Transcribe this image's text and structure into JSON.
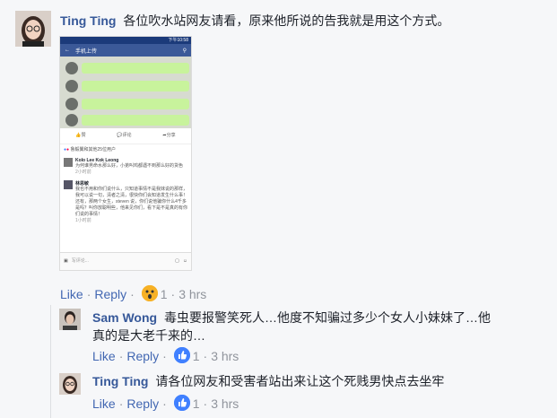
{
  "main_comment": {
    "author": "Ting Ting",
    "text": "各位吹水站网友请看，原来他所说的告我就是用这个方式。",
    "like_label": "Like",
    "reply_label": "Reply",
    "reaction_count": "1",
    "time": "3 hrs"
  },
  "phone": {
    "status_time": "下午10:58",
    "header_title": "手机上传",
    "like_label": "赞",
    "comment_label": "评论",
    "share_label": "分享",
    "reactions_text": "鲁毅翼和其他25位用户",
    "c1_author": "Kolo Lee Kok Leong",
    "c1_text": "为何谁男命水那么好，小弟叫鸡都遇不到那么好的货色",
    "c1_time": "2小时前",
    "c2_author": "林思敏",
    "c2_text": "我也不用和你们说什么，只知道事情不是我妹说的那样，我可以说一句，清者之清，很快你们会知道发生什么事！还有，那两个女生，steven 说，你们说他骗你什么4千多是吗？叫你放聪明些，他来见你们，看下是不是真的有你们说的事情！",
    "c2_time": "1小时前",
    "input_placeholder": "写评论..."
  },
  "replies": [
    {
      "author": "Sam Wong",
      "text_line1": "毒虫要报警笑死人…他度不知骗过多少个女人小妹妹了…他",
      "text_line2": "真的是大老千来的…",
      "like_label": "Like",
      "reply_label": "Reply",
      "reaction_count": "1",
      "time": "3 hrs"
    },
    {
      "author": "Ting Ting",
      "text": "请各位网友和受害者站出来让这个死贱男快点去坐牢",
      "like_label": "Like",
      "reply_label": "Reply",
      "reaction_count": "1",
      "time": "3 hrs"
    }
  ],
  "colors": {
    "link": "#4267b2",
    "name": "#365899",
    "meta": "#90949c",
    "fb_blue": "#3b5998",
    "voice_bubble": "#c8f39c"
  }
}
